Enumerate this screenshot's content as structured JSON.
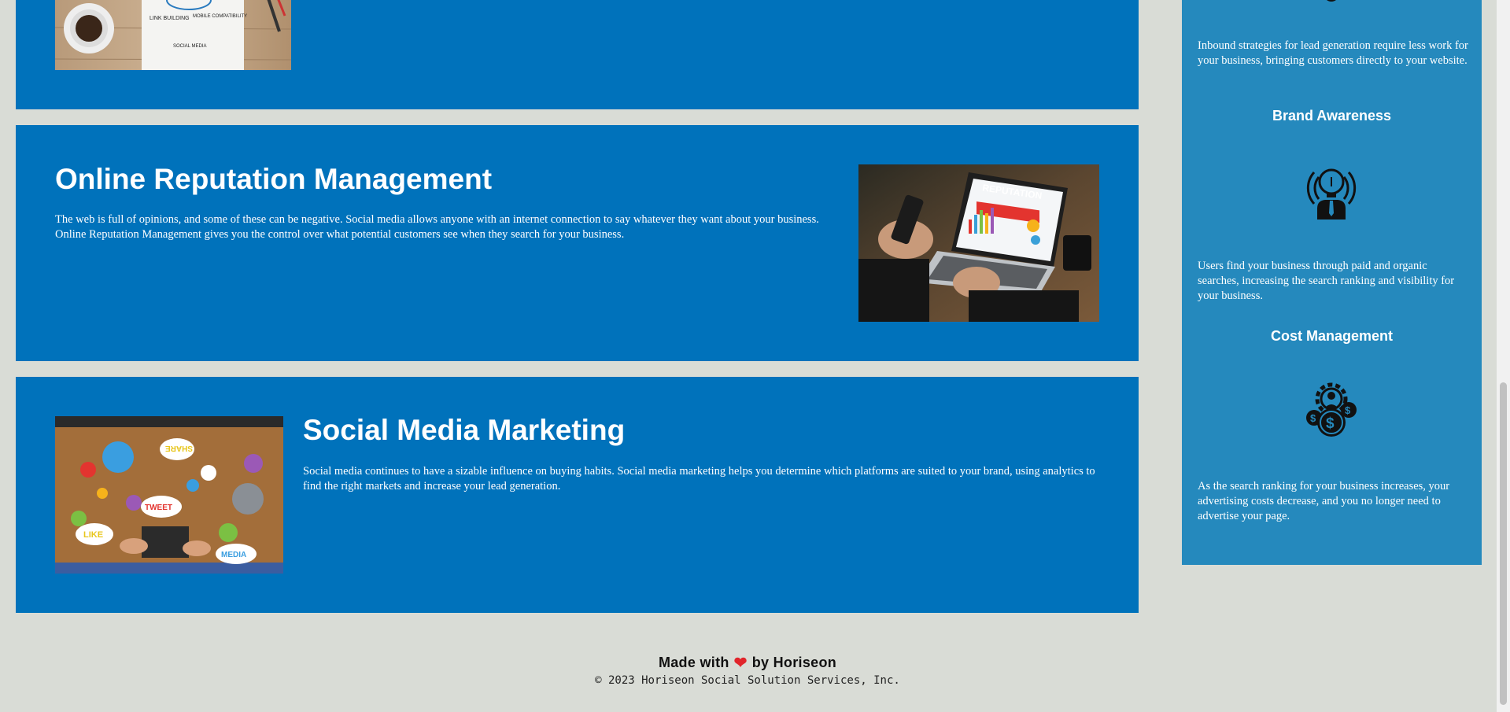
{
  "sections": {
    "seo": {
      "image_alt": "SEO notebook with coffee cup on wooden desk",
      "image_words": [
        "LINK BUILDING",
        "MOBILE COMPATIBILITY",
        "SOCIAL MEDIA"
      ]
    },
    "orm": {
      "title": "Online Reputation Management",
      "text": "The web is full of opinions, and some of these can be negative. Social media allows anyone with an internet connection to say whatever they want about your business. Online Reputation Management gives you the control over what potential customers see when they search for your business.",
      "image_alt": "Laptop screen showing reputation analytics",
      "image_banner": "REPUTATION"
    },
    "smm": {
      "title": "Social Media Marketing",
      "text": "Social media continues to have a sizable influence on buying habits. Social media marketing helps you determine which platforms are suited to your brand, using analytics to find the right markets and increase your lead generation.",
      "image_alt": "People around a table with social media speech bubbles",
      "image_bubbles": [
        "SHARE",
        "TWEET",
        "LIKE",
        "MEDIA"
      ]
    }
  },
  "benefits": {
    "lead": {
      "text": "Inbound strategies for lead generation require less work for your business, bringing customers directly to your website."
    },
    "brand": {
      "title": "Brand Awareness",
      "icon": "lightbulb-person-icon",
      "text": "Users find your business through paid and organic searches, increasing the search ranking and visibility for your business."
    },
    "cost": {
      "title": "Cost Management",
      "icon": "gear-dollar-icon",
      "text": "As the search ranking for your business increases, your advertising costs decrease, and you no longer need to advertise your page."
    }
  },
  "footer": {
    "made_with": "Made with",
    "heart": "❤",
    "by": "by Horiseon",
    "copyright": "© 2023 Horiseon Social Solution Services, Inc."
  },
  "colors": {
    "background": "#d9dcd6",
    "section": "#0072bb",
    "sidebar": "#2589bd",
    "heart": "#e1252b"
  }
}
